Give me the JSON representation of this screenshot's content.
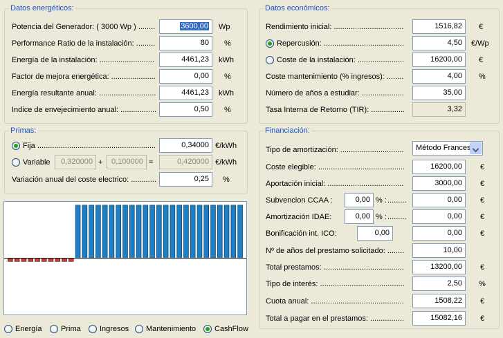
{
  "energy": {
    "title": "Datos energéticos:",
    "rows": [
      {
        "label": "Potencia del Generador:  ( 3000 Wp ) .........",
        "value": "3600,00",
        "unit": "Wp"
      },
      {
        "label": "Performance Ratio de la instalación: ..............",
        "value": "80",
        "unit": "%"
      },
      {
        "label": "Energía de la instalación: ..........................",
        "value": "4461,23",
        "unit": "kWh"
      },
      {
        "label": "Factor de mejora energética: .........................",
        "value": "0,00",
        "unit": "%"
      },
      {
        "label": "Energía resultante anual: ...........................",
        "value": "4461,23",
        "unit": "kWh"
      },
      {
        "label": "Indice de envejecimiento anual: ...................",
        "value": "0,50",
        "unit": "%"
      }
    ]
  },
  "economic": {
    "title": "Datos económicos:",
    "rows": [
      {
        "label": "Rendimiento inicial: ....................................",
        "value": "1516,82",
        "unit": "€"
      },
      {
        "label": "Repercusión: ..........................................",
        "value": "4,50",
        "unit": "€/Wp",
        "radio": true,
        "checked": true
      },
      {
        "label": "Coste de la instalación: ..........................",
        "value": "16200,00",
        "unit": "€",
        "radio": true,
        "checked": false
      },
      {
        "label": "Coste mantenimiento (% ingresos): .............",
        "value": "4,00",
        "unit": "%"
      },
      {
        "label": "Número de años a estudiar: ........................",
        "value": "35,00",
        "unit": ""
      },
      {
        "label": "Tasa Interna de Retorno (TIR): ....................",
        "value": "3,32",
        "unit": "",
        "readonly": true
      }
    ]
  },
  "primas": {
    "title": "Primas:",
    "fija": {
      "label": "Fija",
      "dots": "...............................................................",
      "value": "0,34000",
      "unit": "€/kWh"
    },
    "variable": {
      "label": "Variable",
      "v1": "0,320000",
      "plus": "+",
      "v2": "0,100000",
      "eq": "=",
      "result": "0,420000",
      "unit": "€/kWh"
    },
    "variation": {
      "label": "Variación anual del coste electrico: ..............",
      "value": "0,25",
      "unit": "%"
    }
  },
  "financing": {
    "title": "Financiación:",
    "amortization_label": "Tipo de amortización: ..................................",
    "amortization_value": "Método Frances",
    "rows": [
      {
        "label": "Coste elegible: .............................................",
        "value": "16200,00",
        "unit": "€"
      },
      {
        "label": "Aportación inicial: ...........................................",
        "value": "3000,00",
        "unit": "€"
      },
      {
        "label": "Subvencion CCAA :",
        "small": "0,00",
        "pct": "% :",
        "dots": "...........",
        "value": "0,00",
        "unit": "€"
      },
      {
        "label": "Amortización IDAE:",
        "small": "0,00",
        "pct": "% :",
        "dots": "...........",
        "value": "0,00",
        "unit": "€"
      },
      {
        "label": "Bonificación int. ICO:",
        "small": "0,00",
        "value": "0,00",
        "unit": "€"
      },
      {
        "label": "Nº de años del prestamo solicitado: ..................",
        "value": "10,00",
        "unit": ""
      },
      {
        "label": "Total prestamos: ............................................",
        "value": "13200,00",
        "unit": "€"
      },
      {
        "label": "Tipo de interés: ...........................................",
        "value": "2,50",
        "unit": "%"
      },
      {
        "label": "Cuota anual: ................................................",
        "value": "1508,22",
        "unit": "€"
      },
      {
        "label": "Total a pagar en el prestamos: .........................",
        "value": "15082,16",
        "unit": "€"
      }
    ]
  },
  "chart_options": [
    {
      "label": "Energía",
      "checked": false
    },
    {
      "label": "Prima",
      "checked": false
    },
    {
      "label": "Ingresos",
      "checked": false
    },
    {
      "label": "Mantenimiento",
      "checked": false
    },
    {
      "label": "CashFlow",
      "checked": true
    }
  ],
  "chart_data": {
    "type": "bar",
    "series": [
      {
        "values": [
          -0.2,
          -0.2,
          -0.2,
          -0.2,
          -0.2,
          -0.2,
          -0.2,
          -0.2,
          -0.2,
          -0.2,
          3.2,
          3.2,
          3.2,
          3.2,
          3.2,
          3.2,
          3.2,
          3.2,
          3.2,
          3.2,
          3.2,
          3.2,
          3.2,
          3.2,
          3.2,
          3.2,
          3.2,
          3.2,
          3.2,
          3.2,
          3.2,
          3.2,
          3.2,
          3.2,
          3.2
        ]
      }
    ],
    "ylim": [
      -3.4,
      3.4
    ],
    "colors": {
      "positive": "#1f7fc4",
      "negative": "#c0403a"
    }
  }
}
